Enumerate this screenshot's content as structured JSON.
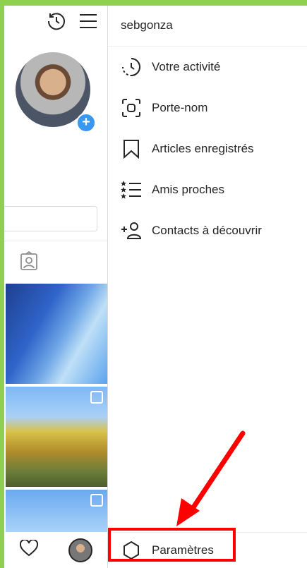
{
  "profile": {
    "username": "sebgonza"
  },
  "menu": {
    "items": [
      {
        "label": "Votre activité",
        "icon": "activity-icon"
      },
      {
        "label": "Porte-nom",
        "icon": "nametag-icon"
      },
      {
        "label": "Articles enregistrés",
        "icon": "bookmark-icon"
      },
      {
        "label": "Amis proches",
        "icon": "close-friends-icon"
      },
      {
        "label": "Contacts à découvrir",
        "icon": "add-person-icon"
      }
    ],
    "settings_label": "Paramètres"
  },
  "colors": {
    "accent": "#3897f0",
    "annotation": "#ff0000",
    "frame": "#8fd14f"
  }
}
